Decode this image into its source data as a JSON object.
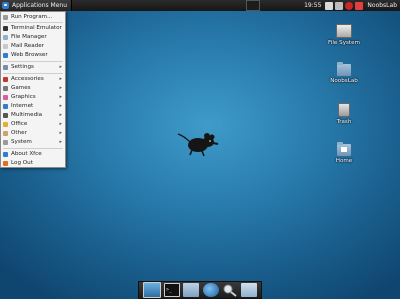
{
  "top_panel": {
    "apps_menu_label": "Applications Menu",
    "clock": "19:55",
    "user": "NoobsLab"
  },
  "apps_menu": {
    "items": [
      {
        "label": "Run Program...",
        "icon": "run-program-icon",
        "color": "#9a9a9a"
      },
      {
        "label": "Terminal Emulator",
        "icon": "terminal-icon",
        "color": "#333333"
      },
      {
        "label": "File Manager",
        "icon": "file-manager-icon",
        "color": "#8fb0cc"
      },
      {
        "label": "Mail Reader",
        "icon": "mail-icon",
        "color": "#c8c8c8"
      },
      {
        "label": "Web Browser",
        "icon": "web-browser-icon",
        "color": "#2f7dcc"
      },
      {
        "label": "Settings",
        "icon": "settings-icon",
        "color": "#7a8fa3",
        "submenu": true
      },
      {
        "label": "Accessories",
        "icon": "accessories-icon",
        "color": "#c0392b",
        "submenu": true
      },
      {
        "label": "Games",
        "icon": "games-icon",
        "color": "#7a7a7a",
        "submenu": true
      },
      {
        "label": "Graphics",
        "icon": "graphics-icon",
        "color": "#d95f9b",
        "submenu": true
      },
      {
        "label": "Internet",
        "icon": "internet-icon",
        "color": "#2f7dcc",
        "submenu": true
      },
      {
        "label": "Multimedia",
        "icon": "multimedia-icon",
        "color": "#555555",
        "submenu": true
      },
      {
        "label": "Office",
        "icon": "office-icon",
        "color": "#e0b030",
        "submenu": true
      },
      {
        "label": "Other",
        "icon": "other-icon",
        "color": "#d2a060",
        "submenu": true
      },
      {
        "label": "System",
        "icon": "system-icon",
        "color": "#9a9a9a",
        "submenu": true
      },
      {
        "label": "About Xfce",
        "icon": "about-icon",
        "color": "#2f7dcc"
      },
      {
        "label": "Log Out",
        "icon": "log-out-icon",
        "color": "#e07020"
      }
    ]
  },
  "desktop_icons": [
    {
      "label": "File System",
      "icon": "drive-icon"
    },
    {
      "label": "NoobsLab",
      "icon": "folder-icon"
    },
    {
      "label": "Trash",
      "icon": "trash-icon"
    },
    {
      "label": "Home",
      "icon": "home-folder-icon"
    }
  ],
  "dock": {
    "terminal_prompt": ">_"
  },
  "colors": {
    "desktop_bg": "#2a7fb0",
    "panel_bg": "#1c1c1c",
    "menu_bg": "#f4f4f4"
  }
}
